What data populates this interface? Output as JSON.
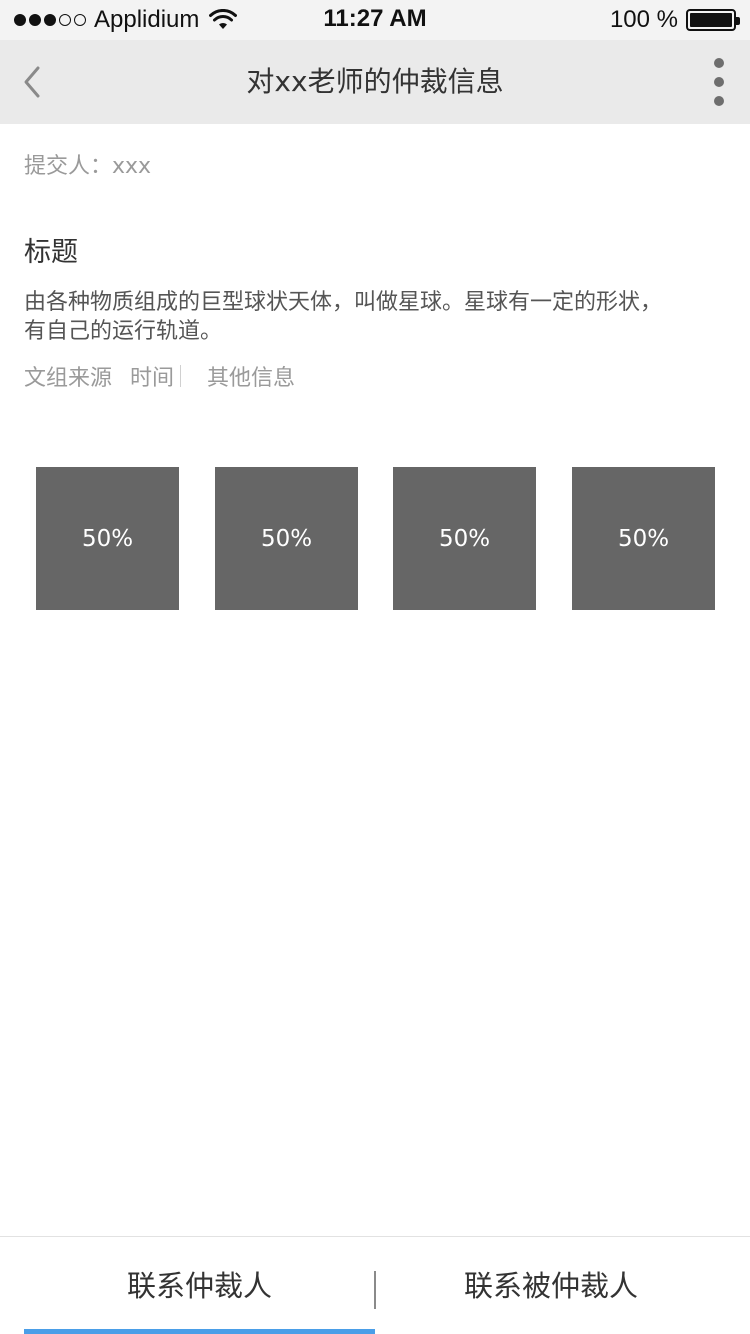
{
  "status_bar": {
    "carrier": "Applidium",
    "time": "11:27 AM",
    "battery_text": "100 %",
    "signal_filled": 3,
    "signal_total": 5
  },
  "nav": {
    "back_icon": "chevron-left-icon",
    "title": "对xx老师的仲裁信息",
    "more_icon": "vertical-dots-icon"
  },
  "content": {
    "submitter": "提交人：xxx",
    "title": "标题",
    "description": "由各种物质组成的巨型球状天体，叫做星球。星球有一定的形状，有自己的运行轨道。",
    "meta": {
      "source": "文组来源",
      "time": "时间",
      "other": "其他信息"
    },
    "tiles": [
      {
        "label": "50%"
      },
      {
        "label": "50%"
      },
      {
        "label": "50%"
      },
      {
        "label": "50%"
      }
    ]
  },
  "bottom_bar": {
    "left_label": "联系仲裁人",
    "right_label": "联系被仲裁人",
    "active": "left",
    "accent_color": "#4a9ee8"
  }
}
